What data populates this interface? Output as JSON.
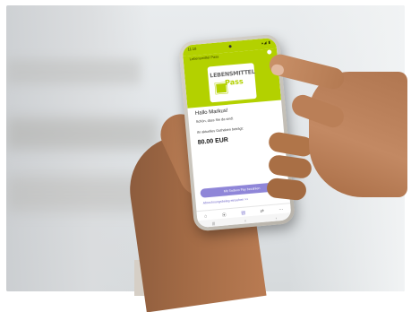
{
  "app": {
    "status_time": "11:18",
    "status_icons": "▴◢ ▮",
    "header_title": "Lebensmittel Pass"
  },
  "logo": {
    "line1": "LEBENSMITTEL",
    "line2": "Pass"
  },
  "main": {
    "greeting": "Hallo Markus!",
    "subtitle": "Schön, dass Sie da sind!",
    "balance_label": "Ihr aktuelles Guthaben beträgt:",
    "balance_value": "80.00 EUR"
  },
  "actions": {
    "pay_button": "Mit Sodexo Pay bezahlen",
    "receipts_link": "Abrechnungsbeleg einsehen >>"
  },
  "nav": {
    "items": [
      "⌂",
      "⦿",
      "▤",
      "⇄",
      "⋯"
    ]
  },
  "system_nav": {
    "items": [
      "|||",
      "○",
      "‹"
    ]
  },
  "colors": {
    "brand_green": "#b3d100",
    "accent_purple": "#8f86d8"
  }
}
